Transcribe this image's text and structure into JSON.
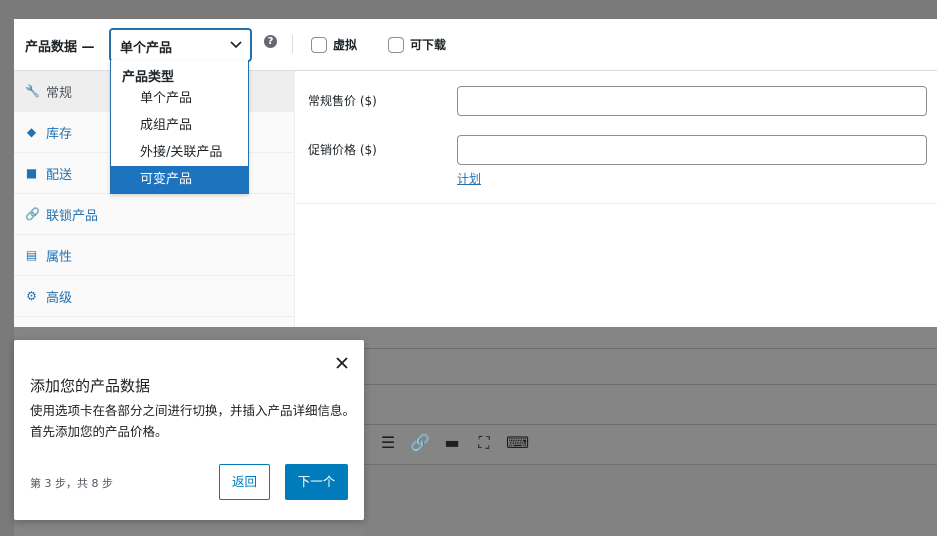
{
  "panel": {
    "title": "产品数据 —",
    "type_select": {
      "value": "单个产品",
      "chevron_icon": "chevron-down-icon"
    },
    "help_icon": "help-icon",
    "virtual_label": "虚拟",
    "downloadable_label": "可下载"
  },
  "tabs": [
    {
      "label": "常规",
      "icon": "wrench-icon",
      "glyph": "🔧",
      "active": true
    },
    {
      "label": "库存",
      "icon": "tag-icon",
      "glyph": "◆",
      "active": false
    },
    {
      "label": "配送",
      "icon": "truck-icon",
      "glyph": "■",
      "active": false
    },
    {
      "label": "联锁产品",
      "icon": "link-icon",
      "glyph": "🔗",
      "active": false
    },
    {
      "label": "属性",
      "icon": "list-icon",
      "glyph": "▤",
      "active": false
    },
    {
      "label": "高级",
      "icon": "gear-icon",
      "glyph": "⚙",
      "active": false
    }
  ],
  "general": {
    "regular_price_label": "常规售价 ($)",
    "sale_price_label": "促销价格 ($)",
    "schedule_link": "计划"
  },
  "dropdown": {
    "group_label": "产品类型",
    "options": [
      {
        "label": "单个产品",
        "selected": false
      },
      {
        "label": "成组产品",
        "selected": false
      },
      {
        "label": "外接/关联产品",
        "selected": false
      },
      {
        "label": "可变产品",
        "selected": true
      }
    ]
  },
  "tour": {
    "title": "添加您的产品数据",
    "body": "使用选项卡在各部分之间进行切换，并插入产品详细信息。 首先添加您的产品价格。",
    "steps": "第 3 步，共 8 步",
    "back_label": "返回",
    "next_label": "下一个"
  },
  "editor_toolbar": {
    "icons": [
      {
        "name": "align-right-icon",
        "glyph": "☰"
      },
      {
        "name": "link-icon",
        "glyph": "🔗"
      },
      {
        "name": "read-more-icon",
        "glyph": "▬"
      },
      {
        "name": "fullscreen-icon",
        "glyph": "⛶"
      },
      {
        "name": "keyboard-icon",
        "glyph": "⌨"
      }
    ]
  }
}
